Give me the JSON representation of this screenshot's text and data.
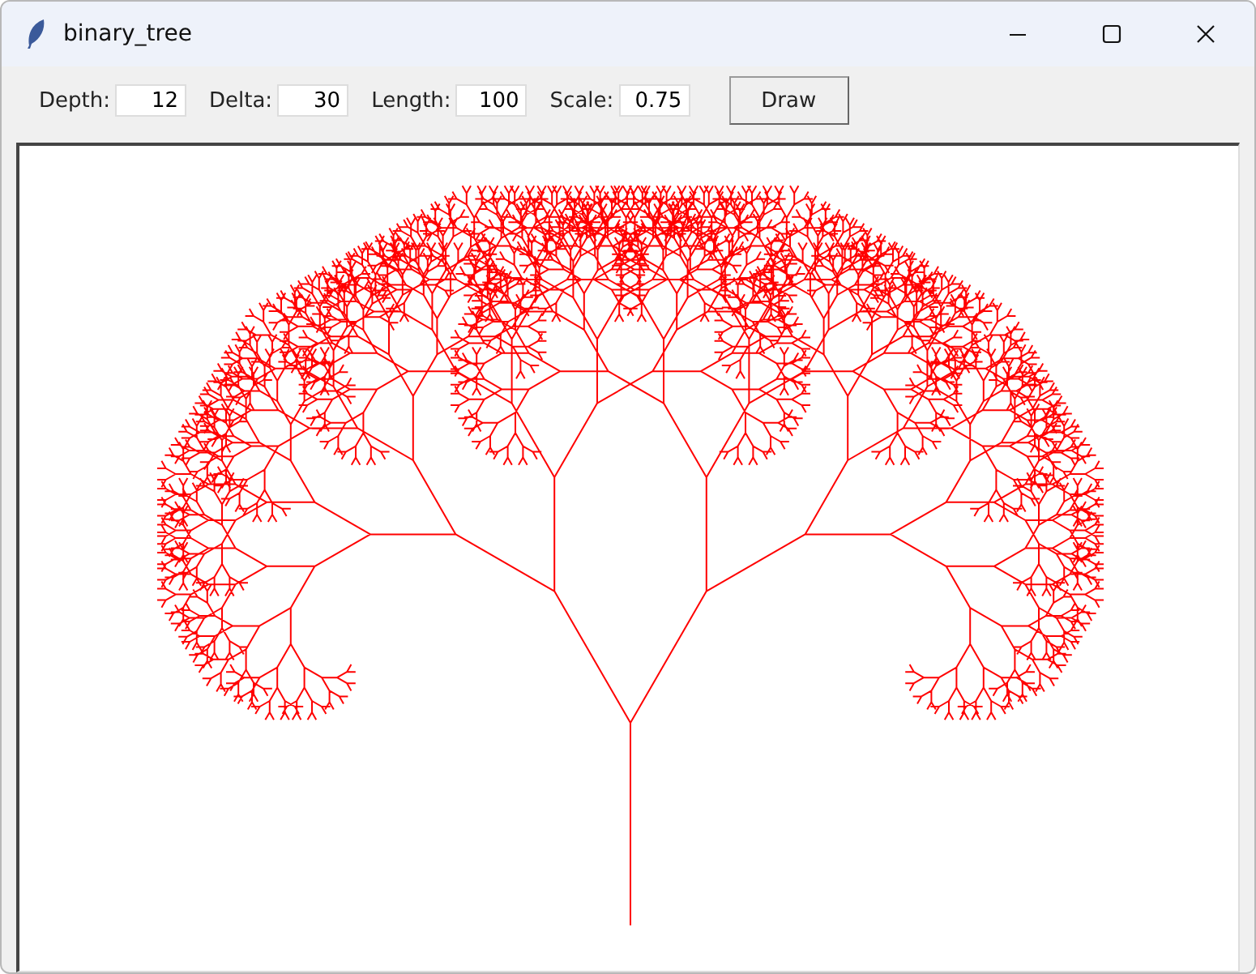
{
  "window": {
    "title": "binary_tree"
  },
  "fields": [
    {
      "label": "Depth:",
      "value": "12"
    },
    {
      "label": "Delta:",
      "value": "30"
    },
    {
      "label": "Length:",
      "value": "100"
    },
    {
      "label": "Scale:",
      "value": "0.75"
    }
  ],
  "button": "Draw"
}
